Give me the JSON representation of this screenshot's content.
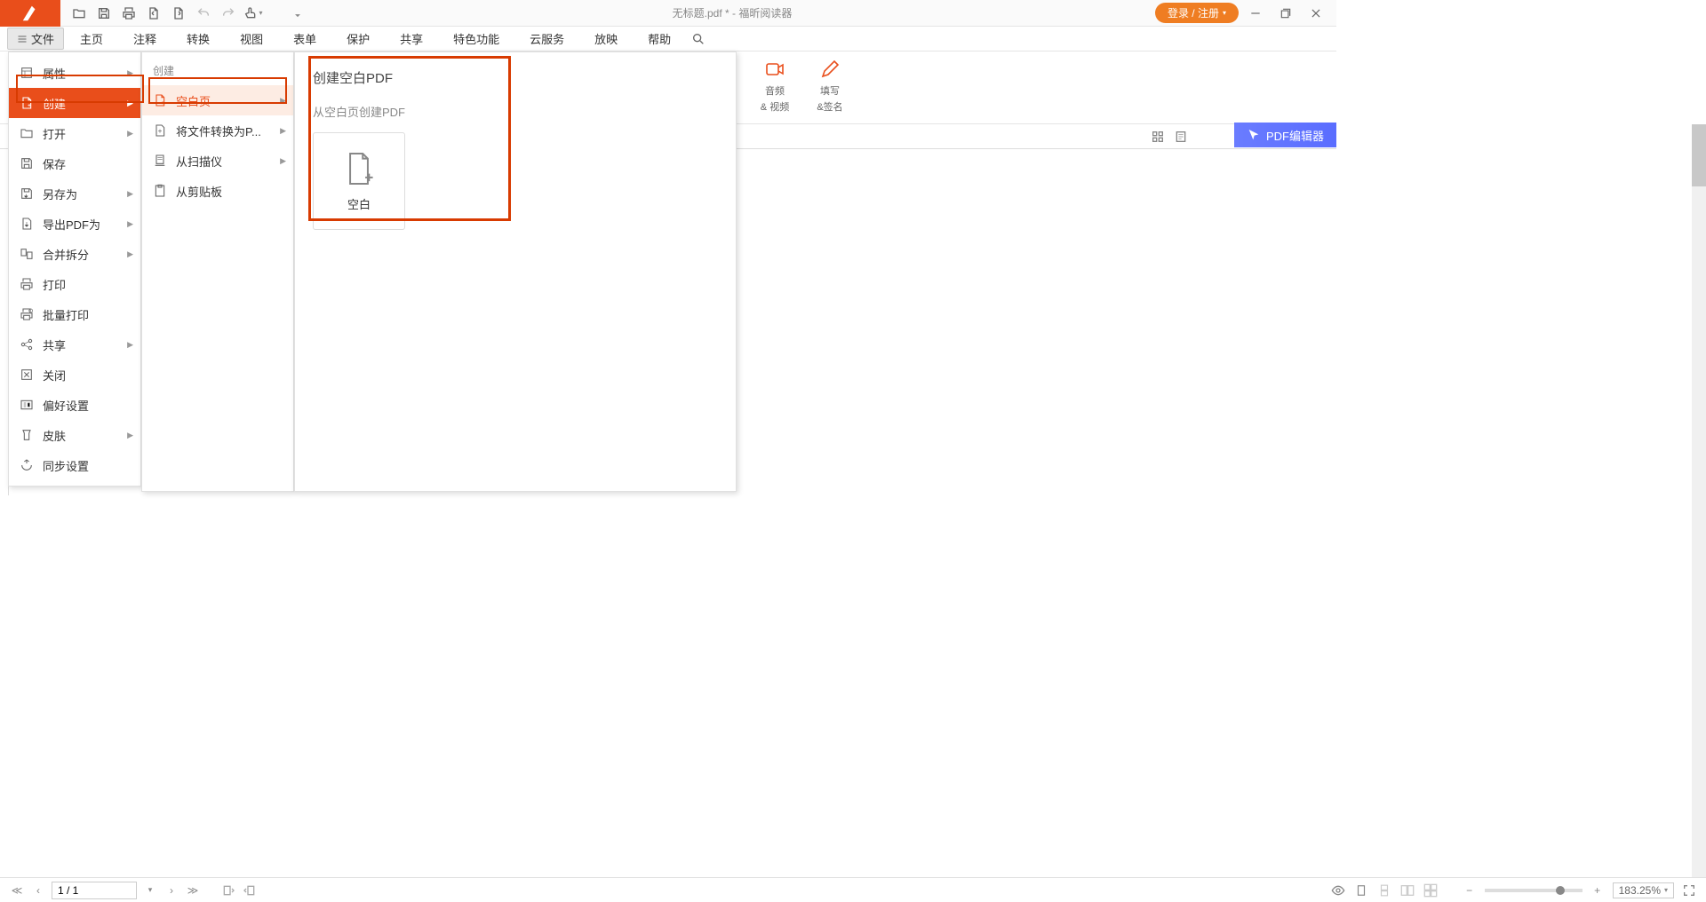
{
  "titlebar": {
    "title": "无标题.pdf * - 福昕阅读器",
    "login": "登录 / 注册"
  },
  "menubar": {
    "file": "文件",
    "items": [
      "主页",
      "注释",
      "转换",
      "视图",
      "表单",
      "保护",
      "共享",
      "特色功能",
      "云服务",
      "放映",
      "帮助"
    ]
  },
  "ribbon": {
    "audio_video_l1": "音频",
    "audio_video_l2": "& 视频",
    "fill_sign_l1": "填写",
    "fill_sign_l2": "&签名"
  },
  "pdf_editor": "PDF编辑器",
  "file_menu": {
    "items": [
      {
        "label": "属性",
        "arrow": true
      },
      {
        "label": "创建",
        "arrow": true,
        "active": true
      },
      {
        "label": "打开",
        "arrow": true
      },
      {
        "label": "保存",
        "arrow": false
      },
      {
        "label": "另存为",
        "arrow": true
      },
      {
        "label": "导出PDF为",
        "arrow": true
      },
      {
        "label": "合并拆分",
        "arrow": true
      },
      {
        "label": "打印",
        "arrow": false
      },
      {
        "label": "批量打印",
        "arrow": false
      },
      {
        "label": "共享",
        "arrow": true
      },
      {
        "label": "关闭",
        "arrow": false
      },
      {
        "label": "偏好设置",
        "arrow": false
      },
      {
        "label": "皮肤",
        "arrow": true
      },
      {
        "label": "同步设置",
        "arrow": false
      }
    ]
  },
  "submenu": {
    "header": "创建",
    "items": [
      {
        "label": "空白页",
        "hl": true,
        "arrow": true
      },
      {
        "label": "将文件转换为P...",
        "arrow": true
      },
      {
        "label": "从扫描仪",
        "arrow": true
      },
      {
        "label": "从剪贴板",
        "arrow": false
      }
    ]
  },
  "detail": {
    "title": "创建空白PDF",
    "subtitle": "从空白页创建PDF",
    "blank_label": "空白"
  },
  "statusbar": {
    "page": "1 / 1",
    "zoom": "183.25%"
  }
}
